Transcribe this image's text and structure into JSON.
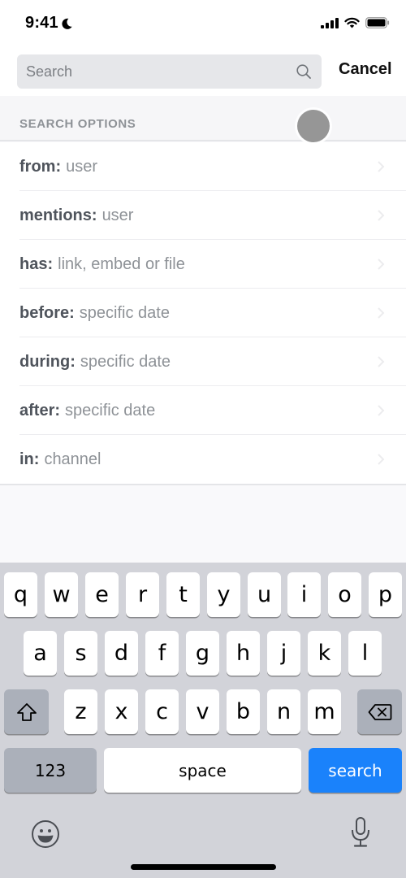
{
  "status_bar": {
    "time": "9:41",
    "icons": [
      "moon-icon",
      "cellular-signal-icon",
      "wifi-icon",
      "battery-icon"
    ]
  },
  "header": {
    "search_placeholder": "Search",
    "search_value": "",
    "search_icon": "magnifier-icon",
    "cancel_label": "Cancel"
  },
  "search_options": {
    "title": "SEARCH OPTIONS",
    "items": [
      {
        "key": "from:",
        "value": "user"
      },
      {
        "key": "mentions:",
        "value": "user"
      },
      {
        "key": "has:",
        "value": "link, embed or file"
      },
      {
        "key": "before:",
        "value": "specific date"
      },
      {
        "key": "during:",
        "value": "specific date"
      },
      {
        "key": "after:",
        "value": "specific date"
      },
      {
        "key": "in:",
        "value": "channel"
      }
    ]
  },
  "keyboard": {
    "row1": [
      "q",
      "w",
      "e",
      "r",
      "t",
      "y",
      "u",
      "i",
      "o",
      "p"
    ],
    "row2": [
      "a",
      "s",
      "d",
      "f",
      "g",
      "h",
      "j",
      "k",
      "l"
    ],
    "row3": [
      "z",
      "x",
      "c",
      "v",
      "b",
      "n",
      "m"
    ],
    "shift_icon": "shift-icon",
    "delete_icon": "backspace-icon",
    "numbers_label": "123",
    "space_label": "space",
    "return_label": "search",
    "emoji_icon": "emoji-icon",
    "mic_icon": "microphone-icon"
  },
  "colors": {
    "accent": "#1a82fb",
    "keyboard_bg": "#d2d3d9",
    "option_key": "#4f545c",
    "option_value": "#8e9297"
  }
}
